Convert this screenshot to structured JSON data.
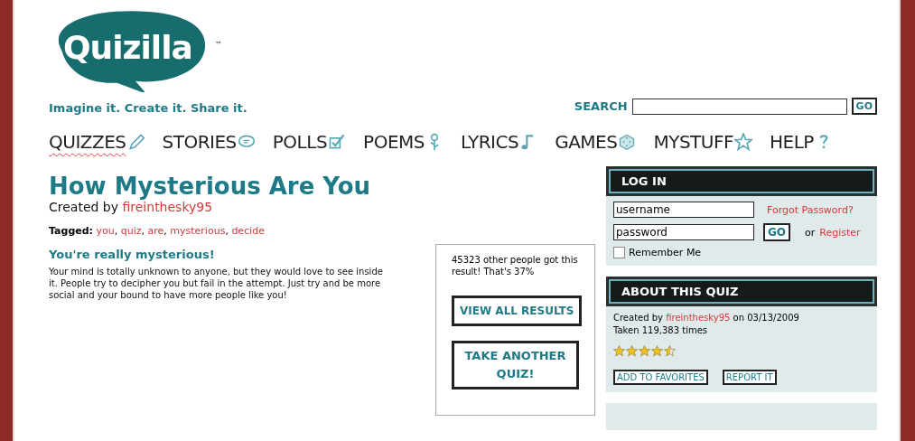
{
  "logo": {
    "name": "Quizilla",
    "mark": "™"
  },
  "tagline": "Imagine it. Create it. Share it.",
  "search": {
    "label": "SEARCH",
    "button": "GO"
  },
  "nav": [
    {
      "label": "QUIZZES",
      "kind": "pencil",
      "selected": true
    },
    {
      "label": "STORIES",
      "kind": "bubble",
      "selected": false
    },
    {
      "label": "POLLS",
      "kind": "checkbox",
      "selected": false
    },
    {
      "label": "POEMS",
      "kind": "flower",
      "selected": false
    },
    {
      "label": "LYRICS",
      "kind": "note",
      "selected": false
    },
    {
      "label": "GAMES",
      "kind": "dice",
      "selected": false
    },
    {
      "label": "MYSTUFF",
      "kind": "star",
      "selected": false
    },
    {
      "label": "HELP",
      "kind": "question",
      "selected": false
    }
  ],
  "quiz": {
    "title": "How Mysterious Are You",
    "created_by": "Created by",
    "author": "fireinthesky95",
    "tagged_label": "Tagged:",
    "tags": [
      "you",
      "quiz",
      "are",
      "mysterious",
      "decide"
    ],
    "separator": ","
  },
  "result": {
    "title": "You're really mysterious!",
    "text": "Your mind is totally unknown to anyone, but they would love to see inside it. People try to decipher you but fail in the attempt. Just try and be more social and your bound to have more people like you!"
  },
  "stats": {
    "text": "45323 other people got this result! That's 37%",
    "buttons": [
      "VIEW ALL RESULTS",
      "TAKE ANOTHER QUIZ!"
    ]
  },
  "login": {
    "title": "LOG IN",
    "username": "username",
    "password": "password",
    "forgot": "Forgot Password?",
    "go": "GO",
    "or": "or",
    "register": "Register",
    "remember": {
      "label": "Remember Me",
      "checked": false
    }
  },
  "about": {
    "title": "ABOUT THIS QUIZ",
    "created_by": "Created by",
    "author": "fireinthesky95",
    "on": "on 03/13/2009",
    "taken": "Taken 119,383 times",
    "stars": 4.5,
    "buttons": [
      "ADD TO FAVORITES",
      "REPORT IT"
    ]
  }
}
